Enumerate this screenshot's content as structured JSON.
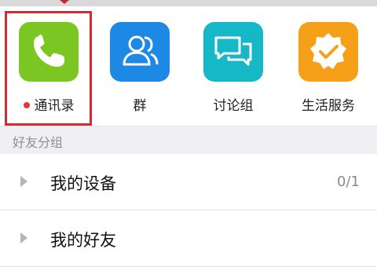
{
  "apps": [
    {
      "label": "通讯录",
      "icon": "phone-icon",
      "color": "#7cc623",
      "has_red_dot": true,
      "highlighted": true
    },
    {
      "label": "群",
      "icon": "group-icon",
      "color": "#1e88e5"
    },
    {
      "label": "讨论组",
      "icon": "discussion-icon",
      "color": "#16b8c8"
    },
    {
      "label": "生活服务",
      "icon": "life-service-icon",
      "color": "#f6a01a"
    }
  ],
  "section": {
    "title": "好友分组"
  },
  "groups": [
    {
      "name": "我的设备",
      "count": "0/1"
    },
    {
      "name": "我的好友",
      "count": ""
    }
  ],
  "colors": {
    "highlight": "#d02c31",
    "section_bg": "#efeff4"
  }
}
